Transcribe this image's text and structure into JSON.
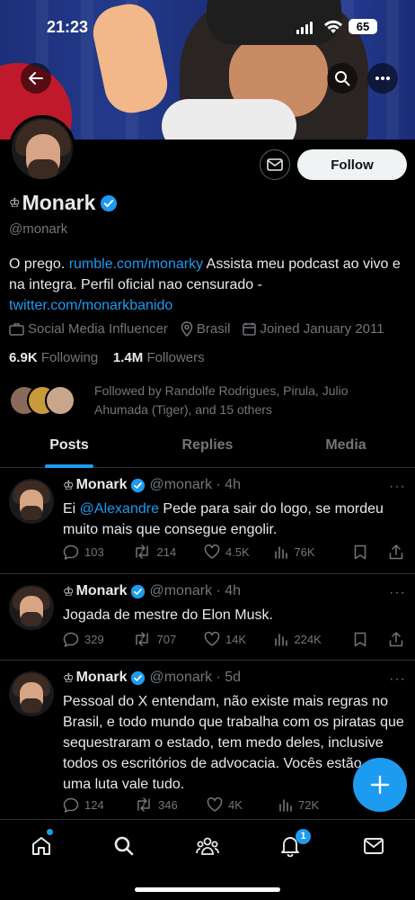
{
  "status_bar": {
    "time": "21:23",
    "battery": "65"
  },
  "profile": {
    "name": "Monark",
    "crown": "♔",
    "handle": "@monark",
    "follow_label": "Follow",
    "bio": {
      "text1": "O prego. ",
      "link1": "rumble.com/monarky",
      "text2": " Assista meu podcast ao vivo e na integra. Perfil oficial nao censurado - ",
      "link2": "twitter.com/monarkbanido"
    },
    "category": "Social Media Influencer",
    "location": "Brasil",
    "joined": "Joined January 2011",
    "following_count": "6.9K",
    "following_label": "Following",
    "followers_count": "1.4M",
    "followers_label": "Followers",
    "followed_by": "Followed by Randolfe Rodrigues, Pirula, Julio Ahumada (Tiger), and 15 others"
  },
  "tabs": [
    {
      "label": "Posts",
      "active": true
    },
    {
      "label": "Replies",
      "active": false
    },
    {
      "label": "Media",
      "active": false
    }
  ],
  "posts": [
    {
      "crown": "♔",
      "name": "Monark",
      "handle_time": "@monark · 4h",
      "mention": "@Alexandre",
      "text_pre": "Ei ",
      "text": " Pede para sair do logo, se mordeu muito mais que consegue engolir.",
      "replies": "103",
      "reposts": "214",
      "likes": "4.5K",
      "views": "76K"
    },
    {
      "crown": "♔",
      "name": "Monark",
      "handle_time": "@monark · 4h",
      "text": "Jogada de mestre do Elon Musk.",
      "replies": "329",
      "reposts": "707",
      "likes": "14K",
      "views": "224K"
    },
    {
      "crown": "♔",
      "name": "Monark",
      "handle_time": "@monark · 5d",
      "text": "Pessoal do X entendam, não existe mais regras no Brasil, e todo mundo que trabalha com os piratas que sequestraram o estado, tem medo deles, inclusive todos os escritórios de advocacia. Vocês estão em uma luta vale tudo.",
      "replies": "124",
      "reposts": "346",
      "likes": "4K",
      "views": "72K"
    }
  ],
  "more_glyph": "···",
  "nav": {
    "notifications_badge": "1"
  },
  "colors": {
    "accent": "#1d9bf0",
    "background": "#000000",
    "text": "#e7e9ea",
    "muted": "#71767b"
  }
}
